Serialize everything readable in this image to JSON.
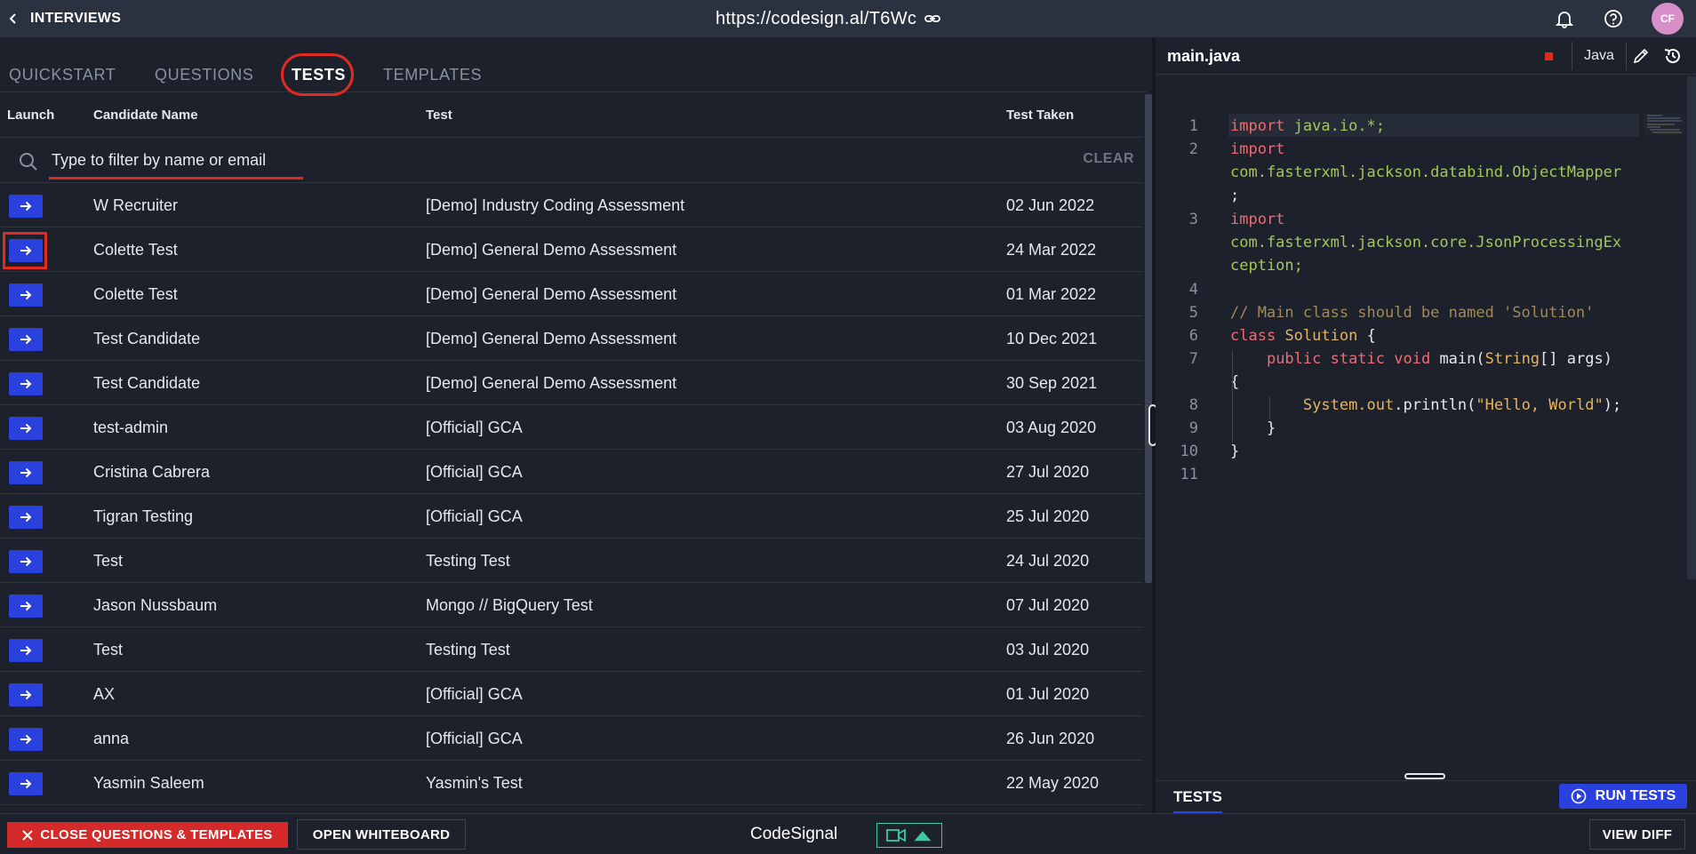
{
  "header": {
    "back_label": "INTERVIEWS",
    "url": "https://codesign.al/T6Wc",
    "avatar_initials": "CF"
  },
  "tabs": [
    {
      "label": "QUICKSTART"
    },
    {
      "label": "QUESTIONS"
    },
    {
      "label": "TESTS"
    },
    {
      "label": "TEMPLATES"
    }
  ],
  "active_tab": "TESTS",
  "table": {
    "columns": [
      "Launch",
      "Candidate Name",
      "Test",
      "Test Taken"
    ],
    "filter_placeholder": "Type to filter by name or email",
    "clear_label": "CLEAR",
    "rows": [
      {
        "name": "W Recruiter",
        "test": "[Demo] Industry Coding Assessment",
        "date": "02 Jun 2022"
      },
      {
        "name": "Colette Test",
        "test": "[Demo] General Demo Assessment",
        "date": "24 Mar 2022"
      },
      {
        "name": "Colette Test",
        "test": "[Demo] General Demo Assessment",
        "date": "01 Mar 2022"
      },
      {
        "name": "Test Candidate",
        "test": "[Demo] General Demo Assessment",
        "date": "10 Dec 2021"
      },
      {
        "name": "Test Candidate",
        "test": "[Demo] General Demo Assessment",
        "date": "30 Sep 2021"
      },
      {
        "name": "test-admin",
        "test": "[Official] GCA",
        "date": "03 Aug 2020"
      },
      {
        "name": "Cristina Cabrera",
        "test": "[Official] GCA",
        "date": "27 Jul 2020"
      },
      {
        "name": "Tigran Testing",
        "test": "[Official] GCA",
        "date": "25 Jul 2020"
      },
      {
        "name": "Test",
        "test": "Testing Test",
        "date": "24 Jul 2020"
      },
      {
        "name": "Jason Nussbaum",
        "test": "Mongo // BigQuery Test",
        "date": "07 Jul 2020"
      },
      {
        "name": "Test",
        "test": "Testing Test",
        "date": "03 Jul 2020"
      },
      {
        "name": "AX",
        "test": "[Official] GCA",
        "date": "01 Jul 2020"
      },
      {
        "name": "anna",
        "test": "[Official] GCA",
        "date": "26 Jun 2020"
      },
      {
        "name": "Yasmin Saleem",
        "test": "Yasmin's Test",
        "date": "22 May 2020"
      }
    ]
  },
  "editor": {
    "filename": "main.java",
    "language": "Java",
    "line_numbers": [
      "1",
      "2",
      "3",
      "4",
      "5",
      "6",
      "7",
      "8",
      "9",
      "10",
      "11"
    ],
    "code": {
      "l1_import": "import",
      "l1_pkg": "java.io.*;",
      "l2_import": "import",
      "l2_pkg": "com.fasterxml.jackson.databind.ObjectMapper",
      "l2_end": ";",
      "l3_import": "import",
      "l3_pkg1": "com.fasterxml.jackson.core.JsonProcessingEx",
      "l3_pkg2": "ception;",
      "l5_comment": "// Main class should be named 'Solution'",
      "l6_class": "class",
      "l6_name": "Solution",
      "l6_brace": "{",
      "l7_mods": "public static void",
      "l7_main": "main(",
      "l7_type": "String",
      "l7_args": "[] args)",
      "l7_brace": "{",
      "l8_sys": "System.",
      "l8_out": "out",
      "l8_println": ".println(",
      "l8_str": "\"Hello, World\"",
      "l8_end": ");",
      "l9": "}",
      "l10": "}"
    }
  },
  "tests_panel": {
    "tab_label": "TESTS",
    "run_label": "RUN TESTS"
  },
  "footer": {
    "close_label": "CLOSE QUESTIONS & TEMPLATES",
    "whiteboard_label": "OPEN WHITEBOARD",
    "brand": "CodeSignal",
    "diff_label": "VIEW DIFF"
  },
  "colors": {
    "accent_blue": "#2a41de",
    "highlight_red": "#e22b20",
    "camera_green": "#3cc9a8"
  }
}
